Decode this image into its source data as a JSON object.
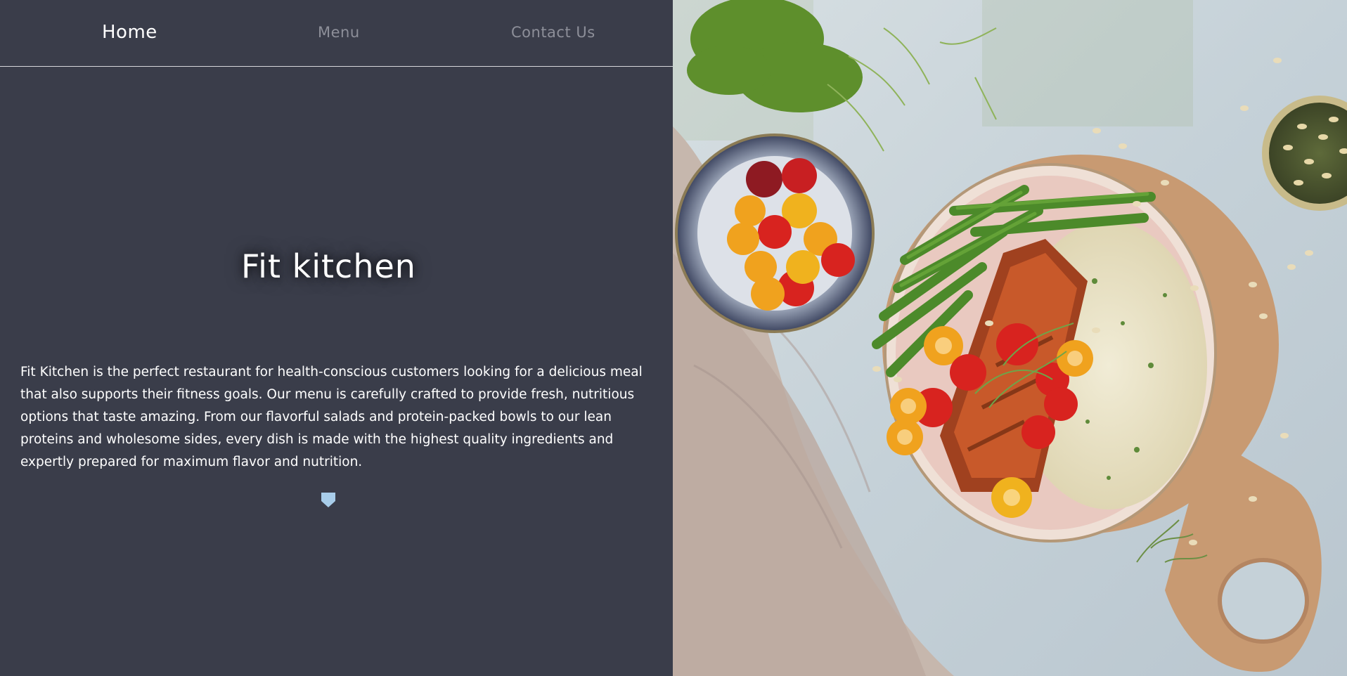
{
  "nav": {
    "home": "Home",
    "menu": "Menu",
    "contact": "Contact Us"
  },
  "hero": {
    "title": "Fit kitchen",
    "description": "Fit Kitchen is the perfect restaurant for health-conscious customers looking for a delicious meal that also supports their fitness goals. Our menu is carefully crafted to provide fresh, nutritious options that taste amazing. From our flavorful salads and protein-packed bowls to our lean proteins and wholesome sides, every dish is made with the highest quality ingredients and expertly prepared for maximum flavor and nutrition.",
    "scroll_icon": "chevron-down-icon"
  },
  "colors": {
    "panel_bg": "#3a3d4a",
    "nav_active": "#ffffff",
    "nav_inactive": "#8d8f99",
    "accent": "#a8cdea"
  }
}
